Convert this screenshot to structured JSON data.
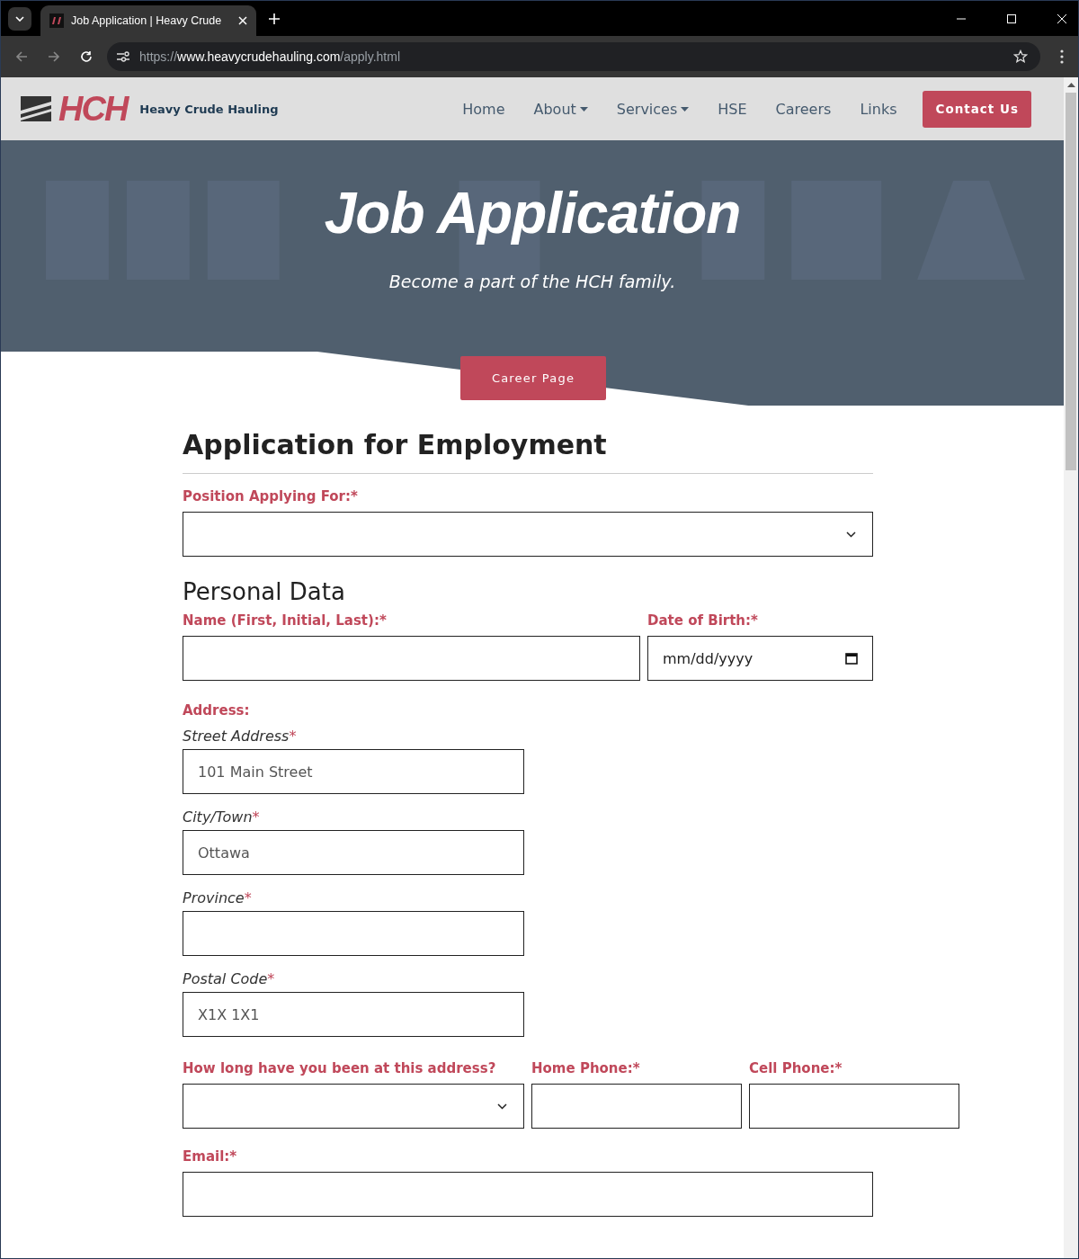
{
  "browser": {
    "tab_title": "Job Application | Heavy Crude",
    "url_scheme": "https://",
    "url_host": "www.heavycrudehauling.com",
    "url_path": "/apply.html"
  },
  "site": {
    "logo_text": "HCH",
    "company": "Heavy Crude Hauling",
    "nav": [
      {
        "label": "Home",
        "dropdown": false
      },
      {
        "label": "About",
        "dropdown": true
      },
      {
        "label": "Services",
        "dropdown": true
      },
      {
        "label": "HSE",
        "dropdown": false
      },
      {
        "label": "Careers",
        "dropdown": false
      },
      {
        "label": "Links",
        "dropdown": false
      }
    ],
    "contact_button": "Contact Us"
  },
  "hero": {
    "title": "Job Application",
    "subtitle": "Become a part of the HCH family.",
    "button": "Career Page"
  },
  "form": {
    "title": "Application for Employment",
    "position": {
      "label": "Position Applying For:*"
    },
    "section": "Personal Data",
    "name": {
      "label": "Name (First, Initial, Last):*"
    },
    "dob": {
      "label": "Date of Birth:*",
      "placeholder": "mm/dd/yyyy"
    },
    "address_label": "Address:",
    "address_fields": [
      {
        "label": "Street Address",
        "required": "*",
        "placeholder": "101 Main Street"
      },
      {
        "label": "City/Town",
        "required": "*",
        "placeholder": "Ottawa"
      },
      {
        "label": "Province",
        "required": "*"
      },
      {
        "label": "Postal Code",
        "required": "*",
        "placeholder": "X1X 1X1"
      }
    ],
    "duration": {
      "label": "How long have you been at this address?"
    },
    "home_phone": {
      "label": "Home Phone:*"
    },
    "cell_phone": {
      "label": "Cell Phone:*"
    },
    "email": {
      "label": "Email:*"
    }
  }
}
